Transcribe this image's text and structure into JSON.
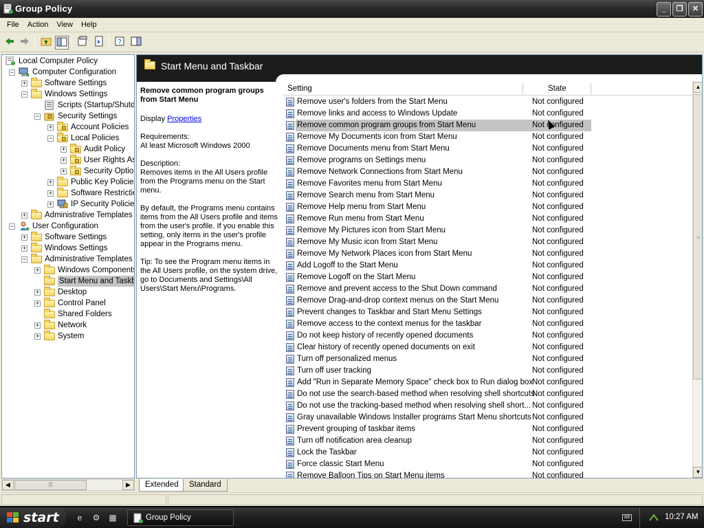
{
  "window": {
    "title": "Group Policy"
  },
  "menu": [
    "File",
    "Action",
    "View",
    "Help"
  ],
  "tree": [
    {
      "label": "Local Computer Policy",
      "level": 0,
      "icon": "computer-policy-icon"
    },
    {
      "label": "Computer Configuration",
      "level": 1,
      "icon": "computer-icon",
      "expander": "minus"
    },
    {
      "label": "Software Settings",
      "level": 2,
      "icon": "folder-icon",
      "expander": "plus"
    },
    {
      "label": "Windows Settings",
      "level": 2,
      "icon": "folder-icon",
      "expander": "minus"
    },
    {
      "label": "Scripts (Startup/Shutdc",
      "level": 3,
      "icon": "scripts-icon"
    },
    {
      "label": "Security Settings",
      "level": 3,
      "icon": "security-icon",
      "expander": "minus"
    },
    {
      "label": "Account Policies",
      "level": 4,
      "icon": "folder-lock-icon",
      "expander": "plus"
    },
    {
      "label": "Local Policies",
      "level": 4,
      "icon": "folder-lock-icon",
      "expander": "minus"
    },
    {
      "label": "Audit Policy",
      "level": 5,
      "icon": "folder-lock-icon",
      "expander": "plus"
    },
    {
      "label": "User Rights As:",
      "level": 5,
      "icon": "folder-lock-icon",
      "expander": "plus"
    },
    {
      "label": "Security Optior",
      "level": 5,
      "icon": "folder-lock-icon",
      "expander": "plus"
    },
    {
      "label": "Public Key Policies",
      "level": 4,
      "icon": "folder-icon",
      "expander": "plus"
    },
    {
      "label": "Software Restrictic",
      "level": 4,
      "icon": "folder-icon",
      "expander": "plus"
    },
    {
      "label": "IP Security Policies",
      "level": 4,
      "icon": "ip-security-icon",
      "expander": "plus"
    },
    {
      "label": "Administrative Templates",
      "level": 2,
      "icon": "folder-icon",
      "expander": "plus"
    },
    {
      "label": "User Configuration",
      "level": 1,
      "icon": "user-icon",
      "expander": "minus"
    },
    {
      "label": "Software Settings",
      "level": 2,
      "icon": "folder-icon",
      "expander": "plus"
    },
    {
      "label": "Windows Settings",
      "level": 2,
      "icon": "folder-icon",
      "expander": "plus"
    },
    {
      "label": "Administrative Templates",
      "level": 2,
      "icon": "folder-icon",
      "expander": "minus"
    },
    {
      "label": "Windows Components",
      "level": 3,
      "icon": "folder-icon",
      "expander": "plus"
    },
    {
      "label": "Start Menu and Taskba",
      "level": 3,
      "icon": "folder-open-icon",
      "selected": true
    },
    {
      "label": "Desktop",
      "level": 3,
      "icon": "folder-icon",
      "expander": "plus"
    },
    {
      "label": "Control Panel",
      "level": 3,
      "icon": "folder-icon",
      "expander": "plus"
    },
    {
      "label": "Shared Folders",
      "level": 3,
      "icon": "folder-icon"
    },
    {
      "label": "Network",
      "level": 3,
      "icon": "folder-icon",
      "expander": "plus"
    },
    {
      "label": "System",
      "level": 3,
      "icon": "folder-icon",
      "expander": "plus"
    }
  ],
  "header": {
    "title": "Start Menu and Taskbar"
  },
  "description": {
    "title": "Remove common program groups from Start Menu",
    "display_prefix": "Display",
    "display_link": "Properties",
    "requirements_label": "Requirements:",
    "requirements": "At least Microsoft Windows 2000",
    "description_label": "Description:",
    "description": "Removes items in the All Users profile from the Programs menu on the Start menu.",
    "details": "By default, the Programs menu contains items from the All Users profile and items from the user's profile. If you enable this setting, only items in the user's profile appear in the Programs menu.",
    "tip": "Tip: To see the Program menu items in the All Users profile, on the system drive, go to Documents and Settings\\All Users\\Start Menu\\Programs."
  },
  "list": {
    "columns": [
      "Setting",
      "State"
    ],
    "rows": [
      {
        "setting": "Remove user's folders from the Start Menu",
        "state": "Not configured"
      },
      {
        "setting": "Remove links and access to Windows Update",
        "state": "Not configured"
      },
      {
        "setting": "Remove common program groups from Start Menu",
        "state": "Not configured",
        "selected": true
      },
      {
        "setting": "Remove My Documents icon from Start Menu",
        "state": "Not configured"
      },
      {
        "setting": "Remove Documents menu from Start Menu",
        "state": "Not configured"
      },
      {
        "setting": "Remove programs on Settings menu",
        "state": "Not configured"
      },
      {
        "setting": "Remove Network Connections from Start Menu",
        "state": "Not configured"
      },
      {
        "setting": "Remove Favorites menu from Start Menu",
        "state": "Not configured"
      },
      {
        "setting": "Remove Search menu from Start Menu",
        "state": "Not configured"
      },
      {
        "setting": "Remove Help menu from Start Menu",
        "state": "Not configured"
      },
      {
        "setting": "Remove Run menu from Start Menu",
        "state": "Not configured"
      },
      {
        "setting": "Remove My Pictures icon from Start Menu",
        "state": "Not configured"
      },
      {
        "setting": "Remove My Music icon from Start Menu",
        "state": "Not configured"
      },
      {
        "setting": "Remove My Network Places icon from Start Menu",
        "state": "Not configured"
      },
      {
        "setting": "Add Logoff to the Start Menu",
        "state": "Not configured"
      },
      {
        "setting": "Remove Logoff on the Start Menu",
        "state": "Not configured"
      },
      {
        "setting": "Remove and prevent access to the Shut Down command",
        "state": "Not configured"
      },
      {
        "setting": "Remove Drag-and-drop context menus on the Start Menu",
        "state": "Not configured"
      },
      {
        "setting": "Prevent changes to Taskbar and Start Menu Settings",
        "state": "Not configured"
      },
      {
        "setting": "Remove access to the context menus for the taskbar",
        "state": "Not configured"
      },
      {
        "setting": "Do not keep history of recently opened documents",
        "state": "Not configured"
      },
      {
        "setting": "Clear history of recently opened documents on exit",
        "state": "Not configured"
      },
      {
        "setting": "Turn off personalized menus",
        "state": "Not configured"
      },
      {
        "setting": "Turn off user tracking",
        "state": "Not configured"
      },
      {
        "setting": "Add \"Run in Separate Memory Space\" check box to Run dialog box",
        "state": "Not configured"
      },
      {
        "setting": "Do not use the search-based method when resolving shell shortcuts",
        "state": "Not configured"
      },
      {
        "setting": "Do not use the tracking-based method when resolving shell short...",
        "state": "Not configured"
      },
      {
        "setting": "Gray unavailable Windows Installer programs Start Menu shortcuts",
        "state": "Not configured"
      },
      {
        "setting": "Prevent grouping of taskbar items",
        "state": "Not configured"
      },
      {
        "setting": "Turn off notification area cleanup",
        "state": "Not configured"
      },
      {
        "setting": "Lock the Taskbar",
        "state": "Not configured"
      },
      {
        "setting": "Force classic Start Menu",
        "state": "Not configured"
      },
      {
        "setting": "Remove Balloon Tips on Start Menu items",
        "state": "Not configured"
      }
    ]
  },
  "tabs": [
    "Extended",
    "Standard"
  ],
  "taskbar": {
    "start": "start",
    "task": "Group Policy",
    "clock": "10:27 AM"
  }
}
